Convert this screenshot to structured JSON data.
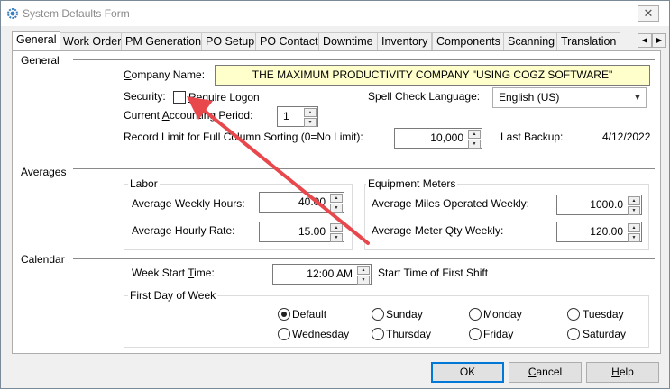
{
  "window": {
    "title": "System Defaults Form",
    "close_glyph": "✕"
  },
  "tabs": [
    {
      "label": "General",
      "active": true
    },
    {
      "label": "Work Order"
    },
    {
      "label": "PM Generation"
    },
    {
      "label": "PO Setup"
    },
    {
      "label": "PO Contact"
    },
    {
      "label": "Downtime"
    },
    {
      "label": "Inventory"
    },
    {
      "label": "Components"
    },
    {
      "label": "Scanning"
    },
    {
      "label": "Translation"
    }
  ],
  "tab_scroll": {
    "left": "◀",
    "right": "▶"
  },
  "general": {
    "section_label": "General",
    "company_label_pre": "",
    "company_label_u": "C",
    "company_label_post": "ompany Name:",
    "company_name": "THE MAXIMUM PRODUCTIVITY COMPANY \"USING COGZ SOFTWARE\"",
    "security_label": "Security:",
    "require_logon_u": "R",
    "require_logon_post": "equire Logon",
    "require_logon_checked": false,
    "spell_label": "Spell Check Language:",
    "spell_value": "English (US)",
    "period_label_pre": "Current ",
    "period_label_u": "A",
    "period_label_post": "ccounting Period:",
    "period_value": "1",
    "record_limit_label": "Record Limit for Full Column Sorting (0=No Limit):",
    "record_limit_value": "10,000",
    "last_backup_label": "Last Backup:",
    "last_backup_value": "4/12/2022"
  },
  "averages": {
    "section_label": "Averages",
    "labor_title": "Labor",
    "weekly_hours_label": "Average Weekly Hours:",
    "weekly_hours_value": "40.00",
    "hourly_rate_label": "Average Hourly Rate:",
    "hourly_rate_value": "15.00",
    "meters_title": "Equipment Meters",
    "miles_label": "Average Miles Operated  Weekly:",
    "miles_value": "1000.0",
    "meter_qty_label": "Average Meter Qty Weekly:",
    "meter_qty_value": "120.00"
  },
  "calendar": {
    "section_label": "Calendar",
    "week_start_label_pre": "Week Start ",
    "week_start_label_u": "T",
    "week_start_label_post": "ime:",
    "week_start_value": "12:00 AM",
    "first_shift_label": "Start Time of First Shift",
    "first_day_title": "First Day of Week",
    "days": [
      {
        "label": "Default",
        "selected": true
      },
      {
        "label": "Sunday"
      },
      {
        "label": "Monday"
      },
      {
        "label": "Tuesday"
      },
      {
        "label": "Wednesday"
      },
      {
        "label": "Thursday"
      },
      {
        "label": "Friday"
      },
      {
        "label": "Saturday"
      }
    ]
  },
  "buttons": {
    "ok": "OK",
    "cancel_u": "C",
    "cancel_post": "ancel",
    "help_u": "H",
    "help_post": "elp"
  },
  "annotation": {
    "arrow_color": "#e8474c"
  }
}
